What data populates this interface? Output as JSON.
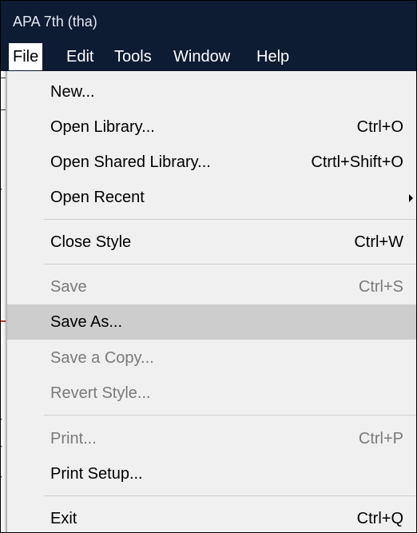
{
  "window": {
    "title": "APA 7th (tha)"
  },
  "menubar": {
    "items": [
      {
        "label": "File"
      },
      {
        "label": "Edit"
      },
      {
        "label": "Tools"
      },
      {
        "label": "Window"
      },
      {
        "label": "Help"
      }
    ],
    "active": "File"
  },
  "file_menu": {
    "items": [
      {
        "label": "New...",
        "shortcut": "",
        "enabled": true
      },
      {
        "label": "Open Library...",
        "shortcut": "Ctrl+O",
        "enabled": true
      },
      {
        "label": "Open Shared Library...",
        "shortcut": "Ctrtl+Shift+O",
        "enabled": true
      },
      {
        "label": "Open Recent",
        "shortcut": "",
        "submenu": true,
        "enabled": true
      },
      {
        "label": "Close Style",
        "shortcut": "Ctrl+W",
        "enabled": true
      },
      {
        "label": "Save",
        "shortcut": "Ctrl+S",
        "enabled": false
      },
      {
        "label": "Save As...",
        "shortcut": "",
        "enabled": true,
        "highlighted": true
      },
      {
        "label": "Save a Copy...",
        "shortcut": "",
        "enabled": false
      },
      {
        "label": "Revert Style...",
        "shortcut": "",
        "enabled": false
      },
      {
        "label": "Print...",
        "shortcut": "Ctrl+P",
        "enabled": false
      },
      {
        "label": "Print Setup...",
        "shortcut": "",
        "enabled": true
      },
      {
        "label": "Exit",
        "shortcut": "Ctrl+Q",
        "enabled": true
      }
    ]
  },
  "colors": {
    "titlebar": "#0d1b33",
    "menu_bg": "#f0f0f0",
    "highlight": "#cdcdcd",
    "disabled_text": "#7a7a7a"
  }
}
